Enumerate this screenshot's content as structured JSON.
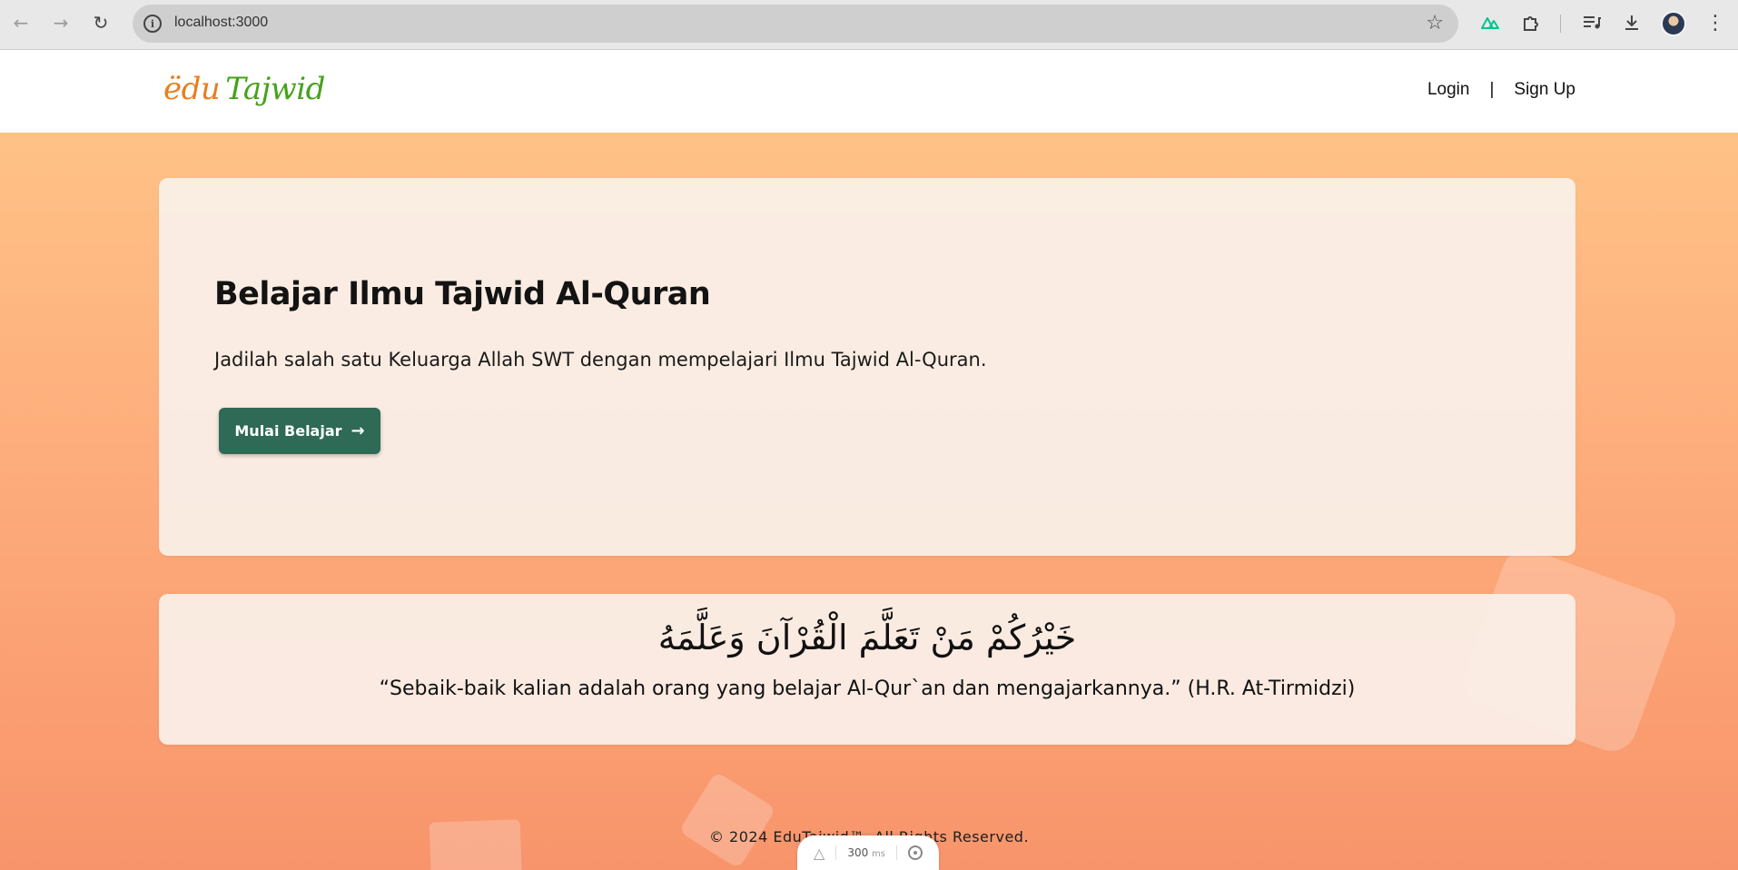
{
  "browser": {
    "back_icon": "←",
    "forward_icon": "→",
    "reload_icon": "↻",
    "info_icon": "i",
    "url": "localhost:3000",
    "star_icon": "☆",
    "extensions": [
      "nuxt-devtools-icon",
      "puzzle-extensions-icon",
      "media-queue-icon",
      "download-icon"
    ],
    "menu_icon": "⋮"
  },
  "header": {
    "logo_edu": "ëdu",
    "logo_tajwid": "Tajwid",
    "login_label": "Login",
    "separator": "|",
    "signup_label": "Sign Up"
  },
  "hero": {
    "title": "Belajar Ilmu Tajwid Al-Quran",
    "subtitle": "Jadilah salah satu Keluarga Allah SWT dengan mempelajari Ilmu Tajwid Al-Quran.",
    "cta_label": "Mulai Belajar",
    "cta_arrow": "→",
    "cta_color": "#2e6a55"
  },
  "quote": {
    "arabic": "خَيْرُكُمْ مَنْ تَعَلَّمَ الْقُرْآنَ وَعَلَّمَهُ",
    "translation": "“Sebaik-baik kalian adalah orang yang belajar Al-Qur`an dan mengajarkannya.” (H.R. At-Tirmidzi)"
  },
  "footer": {
    "copyright": "© 2024 EduTajwid™. All Rights Reserved."
  },
  "devtools": {
    "logo_icon": "△",
    "timing_value": "300",
    "timing_unit": "ms"
  },
  "colors": {
    "logo_orange": "#e87e1e",
    "logo_green": "#45a21a",
    "bg_top": "#ffc286",
    "bg_bottom": "#f8946b"
  }
}
